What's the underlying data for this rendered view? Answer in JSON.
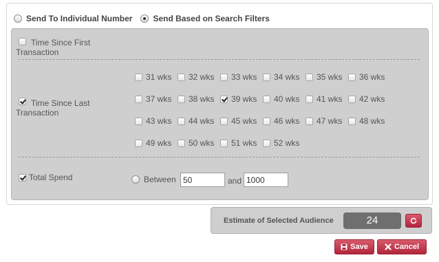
{
  "send_mode": {
    "individual_label": "Send To Individual Number",
    "filters_label": "Send Based on Search Filters",
    "selected": "filters"
  },
  "filters": {
    "first_transaction": {
      "label": "Time Since First Transaction",
      "checked": false
    },
    "last_transaction": {
      "label": "Time Since Last Transaction",
      "checked": true,
      "weeks": [
        {
          "label": "31 wks",
          "checked": false
        },
        {
          "label": "32 wks",
          "checked": false
        },
        {
          "label": "33 wks",
          "checked": false
        },
        {
          "label": "34 wks",
          "checked": false
        },
        {
          "label": "35 wks",
          "checked": false
        },
        {
          "label": "36 wks",
          "checked": false
        },
        {
          "label": "37 wks",
          "checked": false
        },
        {
          "label": "38 wks",
          "checked": false
        },
        {
          "label": "39 wks",
          "checked": true
        },
        {
          "label": "40 wks",
          "checked": false
        },
        {
          "label": "41 wks",
          "checked": false
        },
        {
          "label": "42 wks",
          "checked": false
        },
        {
          "label": "43 wks",
          "checked": false
        },
        {
          "label": "44 wks",
          "checked": false
        },
        {
          "label": "45 wks",
          "checked": false
        },
        {
          "label": "46 wks",
          "checked": false
        },
        {
          "label": "47 wks",
          "checked": false
        },
        {
          "label": "48 wks",
          "checked": false
        },
        {
          "label": "49 wks",
          "checked": false
        },
        {
          "label": "50 wks",
          "checked": false
        },
        {
          "label": "51 wks",
          "checked": false
        },
        {
          "label": "52 wks",
          "checked": false
        }
      ]
    },
    "total_spend": {
      "label": "Total Spend",
      "checked": true,
      "between_label": "Between",
      "and_label": "and",
      "min_value": "50",
      "max_value": "1000"
    }
  },
  "estimate": {
    "label": "Estimate of Selected Audience",
    "value": "24"
  },
  "actions": {
    "save_label": "Save",
    "cancel_label": "Cancel"
  },
  "colors": {
    "accent": "#c0344a",
    "panel": "#cfcfcf",
    "estimate_value_bg": "#6f6f6f"
  },
  "icons": {
    "refresh": "refresh-icon",
    "save": "floppy-icon",
    "cancel": "close-icon"
  }
}
